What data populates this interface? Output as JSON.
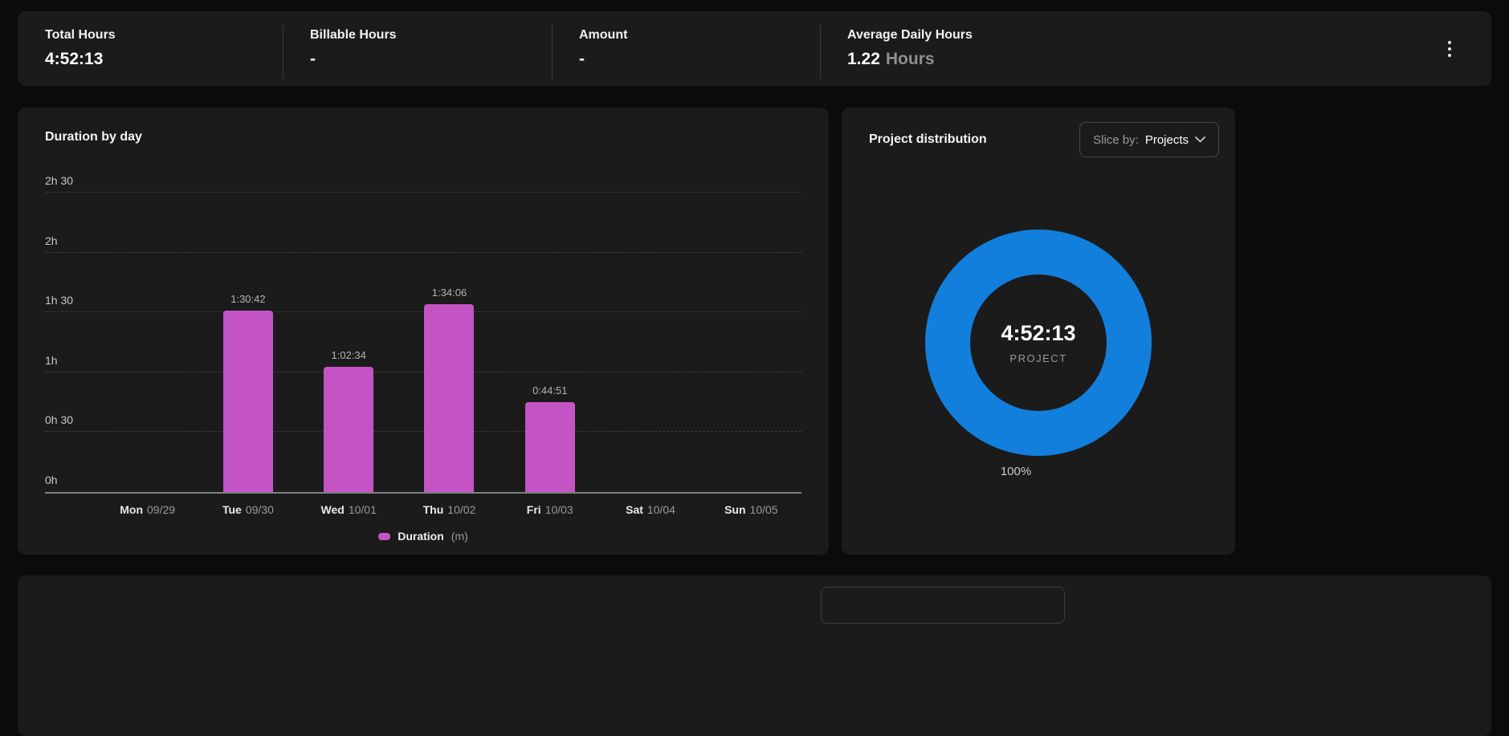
{
  "colors": {
    "bar_accent": "#c454c4",
    "donut_accent": "#127fdd"
  },
  "stats_bar": {
    "items": [
      {
        "label": "Total Hours",
        "value": "4:52:13",
        "suffix": ""
      },
      {
        "label": "Billable Hours",
        "value": "-",
        "suffix": ""
      },
      {
        "label": "Amount",
        "value": "-",
        "suffix": ""
      },
      {
        "label": "Average Daily Hours",
        "value": "1.22",
        "suffix": "Hours"
      }
    ],
    "menu_icon": "kebab-menu-icon"
  },
  "distribution_panel": {
    "slice_by_prefix": "Slice by:",
    "slice_by_value": "Projects",
    "chevron_icon": "chevron-down-icon"
  },
  "chart_data": [
    {
      "type": "bar",
      "title": "Duration by day",
      "categories": [
        "Mon 09/29",
        "Tue 09/30",
        "Wed 10/01",
        "Thu 10/02",
        "Fri 10/03",
        "Sat 10/04",
        "Sun 10/05"
      ],
      "x_tick_days": [
        "Mon",
        "Tue",
        "Wed",
        "Thu",
        "Fri",
        "Sat",
        "Sun"
      ],
      "x_tick_dates": [
        "09/29",
        "09/30",
        "10/01",
        "10/02",
        "10/03",
        "10/04",
        "10/05"
      ],
      "values_minutes": [
        0,
        90.7,
        62.57,
        94.1,
        44.85,
        0,
        0
      ],
      "bar_duration_labels": [
        "",
        "1:30:42",
        "1:02:34",
        "1:34:06",
        "0:44:51",
        "",
        ""
      ],
      "y_tick_labels": [
        "0h",
        "0h 30",
        "1h",
        "1h 30",
        "2h",
        "2h 30"
      ],
      "y_tick_step_minutes": 30,
      "ylim_minutes": [
        0,
        150
      ],
      "grid": "horizontal-dashed",
      "bar_color": "#c454c4",
      "legend": {
        "label": "Duration",
        "unit": "(m)",
        "swatch_color": "#c454c4",
        "position": "bottom-center"
      }
    },
    {
      "type": "donut",
      "title": "Project distribution",
      "center_value": "4:52:13",
      "center_label": "PROJECT",
      "slices": [
        {
          "label": "100%",
          "value_percent": 100,
          "color": "#127fdd"
        }
      ]
    }
  ]
}
